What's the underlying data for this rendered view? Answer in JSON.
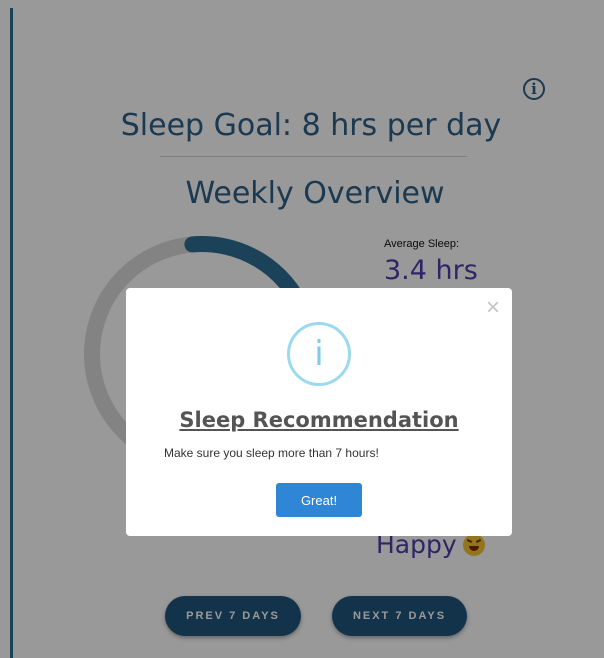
{
  "info_icon": "info-icon",
  "sleep_goal": "Sleep Goal: 8 hrs per day",
  "overview_title": "Weekly Overview",
  "average": {
    "label": "Average Sleep:",
    "value": "3.4 hrs",
    "progress_fraction": 0.2
  },
  "mood": {
    "value": "Happy",
    "emoji": "grinning-squinting-face"
  },
  "buttons": {
    "prev": "PREV 7 DAYS",
    "next": "NEXT 7 DAYS"
  },
  "modal": {
    "close": "×",
    "icon_glyph": "i",
    "title": "Sleep Recommendation",
    "message": "Make sure you sleep more than 7 hours!",
    "confirm": "Great!"
  },
  "colors": {
    "primary": "#2d5f85",
    "accent": "#4b3fa8",
    "ring_track": "#dadada",
    "ring_fill": "#2f6f95",
    "confirm": "#2f86d6"
  }
}
